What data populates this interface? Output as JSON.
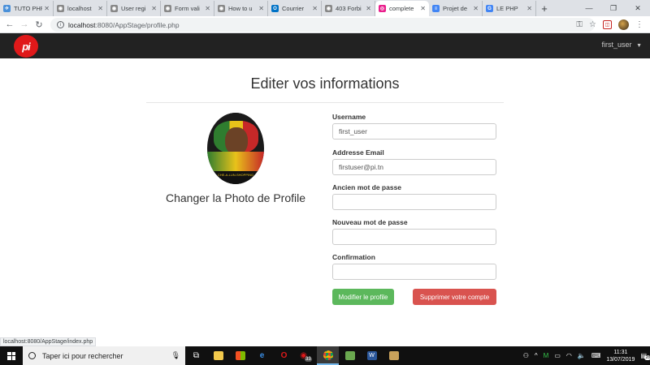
{
  "browser": {
    "tabs": [
      {
        "label": "TUTO PHP",
        "color": "#4a90d9",
        "glyph": "✈"
      },
      {
        "label": "localhost",
        "color": "#888888",
        "glyph": "◉"
      },
      {
        "label": "User regi",
        "color": "#888888",
        "glyph": "◉"
      },
      {
        "label": "Form vali",
        "color": "#888888",
        "glyph": "◉"
      },
      {
        "label": "How to u",
        "color": "#888888",
        "glyph": "◉"
      },
      {
        "label": "Courrier",
        "color": "#0072c6",
        "glyph": "O"
      },
      {
        "label": "403 Forbi",
        "color": "#888888",
        "glyph": "◉"
      },
      {
        "label": "complete",
        "color": "#e91e8c",
        "glyph": "◎"
      },
      {
        "label": "Projet de",
        "color": "#4285f4",
        "glyph": "≡"
      },
      {
        "label": "LE PHP",
        "color": "#4285f4",
        "glyph": "G"
      }
    ],
    "active_tab_index": 7,
    "address_host": "localhost",
    "address_path": ":8080/AppStage/profile.php",
    "status_url": "localhost:8080/AppStage/index.php"
  },
  "site": {
    "logo_text": "pi",
    "user_menu": "first_user"
  },
  "page": {
    "title": "Editer vos informations",
    "photo_caption": "Changer la Photo de Profile",
    "photo_text": "CHE-A-LUN-SHOPPING"
  },
  "form": {
    "username_label": "Username",
    "username_value": "first_user",
    "email_label": "Addresse Email",
    "email_value": "firstuser@pi.tn",
    "old_password_label": "Ancien mot de passe",
    "new_password_label": "Nouveau mot de passe",
    "confirm_label": "Confirmation",
    "submit_label": "Modifier le profile",
    "delete_label": "Supprimer votre compte",
    "colors": {
      "success": "#5cb85c",
      "danger": "#d9534f"
    }
  },
  "taskbar": {
    "search_placeholder": "Taper ici pour rechercher",
    "time": "11:31",
    "date": "13/07/2019",
    "notification_count": "28",
    "opera_badge": "33"
  }
}
